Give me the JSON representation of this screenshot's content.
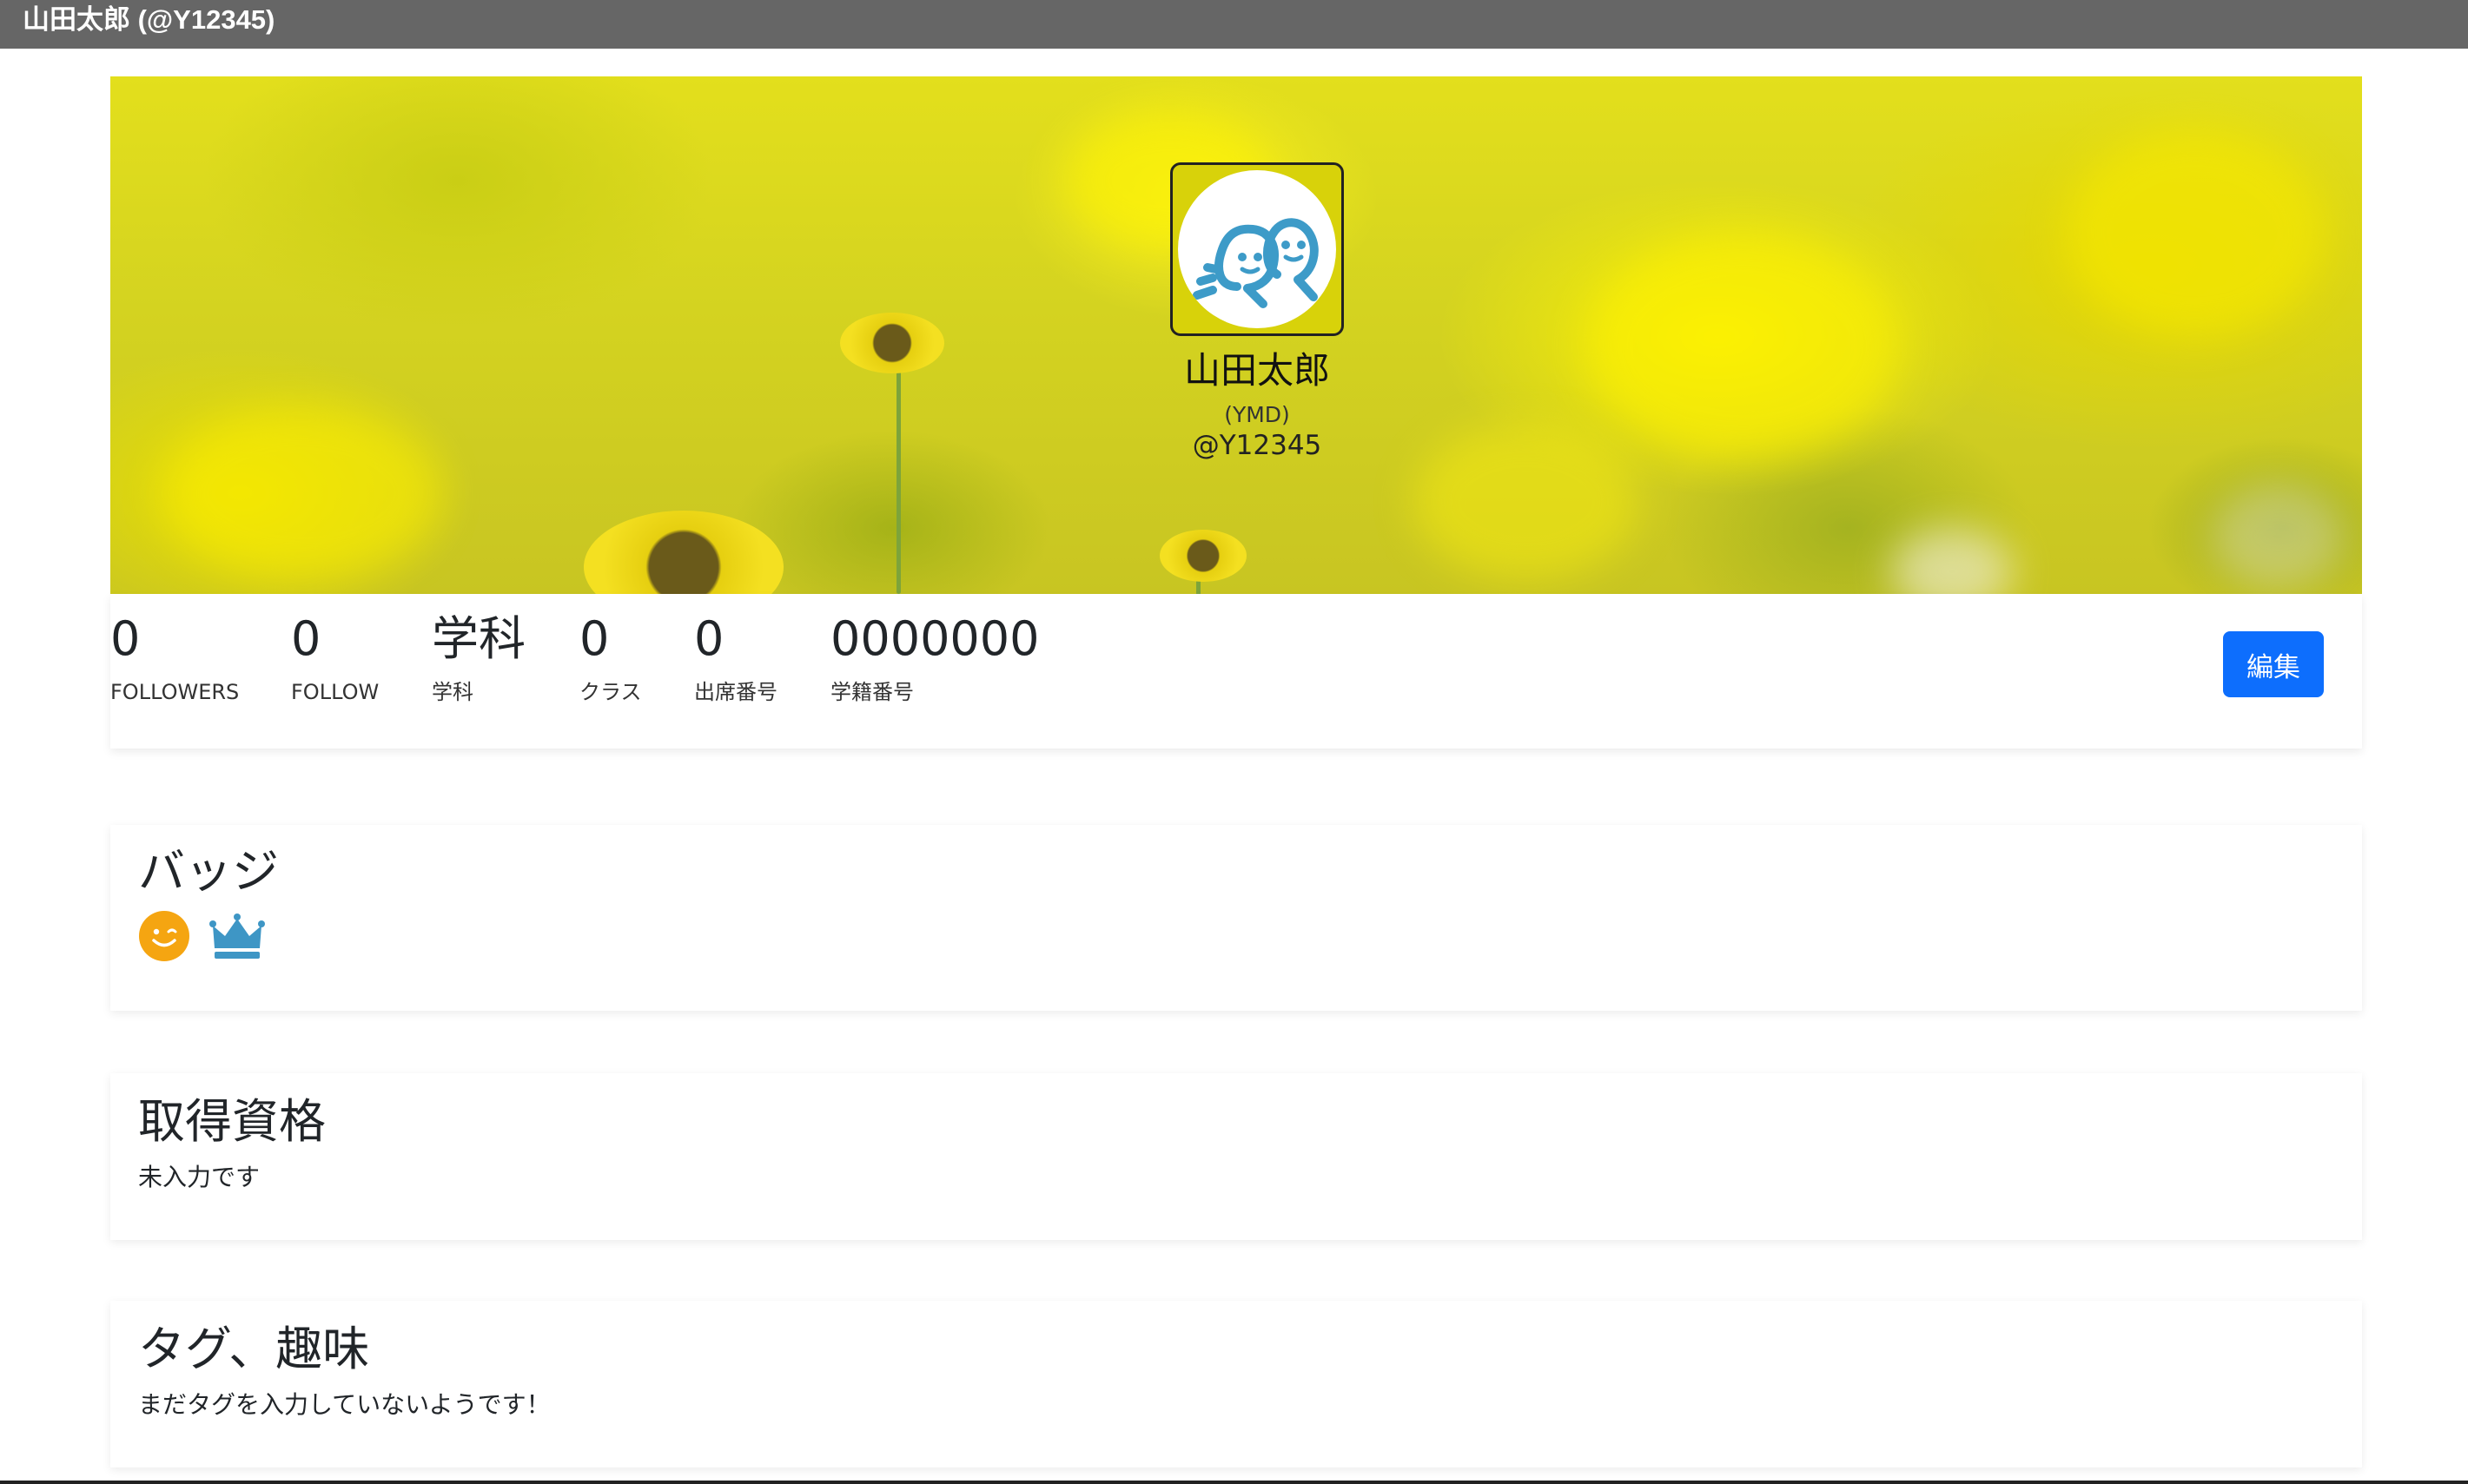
{
  "window": {
    "title": "山田太郎 (@Y12345)"
  },
  "profile": {
    "name": "山田太郎",
    "reading": "(YMD)",
    "handle": "@Y12345",
    "avatar_icon": "two-smiling-figures-icon"
  },
  "stats": [
    {
      "value": "0",
      "label": "FOLLOWERS"
    },
    {
      "value": "0",
      "label": "FOLLOW"
    },
    {
      "value": "学科",
      "label": "学科"
    },
    {
      "value": "0",
      "label": "クラス"
    },
    {
      "value": "0",
      "label": "出席番号"
    },
    {
      "value": "0000000",
      "label": "学籍番号"
    }
  ],
  "edit_button": {
    "label": "編集"
  },
  "badges": {
    "title": "バッジ",
    "items": [
      {
        "icon": "smiley-face-icon",
        "color": "#f5a511"
      },
      {
        "icon": "crown-icon",
        "color": "#3e96c5"
      }
    ]
  },
  "qualifications": {
    "title": "取得資格",
    "text": "未入力です"
  },
  "tags": {
    "title": "タグ、趣味",
    "text": "まだタグを入力していないようです！"
  },
  "colors": {
    "accent": "#0d6efd",
    "titlebar": "#666666"
  }
}
